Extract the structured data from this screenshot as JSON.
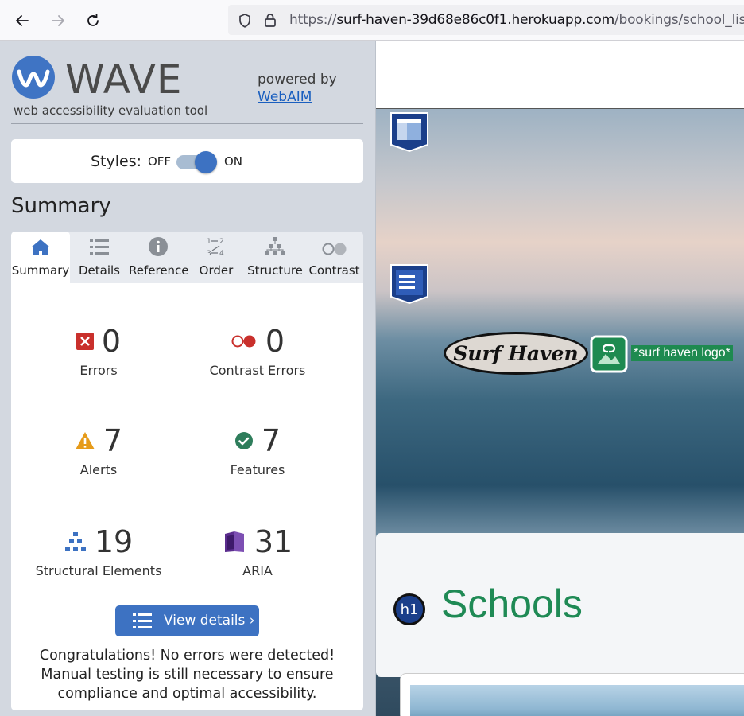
{
  "browser": {
    "url_prefix": "https://",
    "url_host": "surf-haven-39d68e86c0f1.herokuapp.com",
    "url_path": "/bookings/school_list/"
  },
  "wave": {
    "logo_text": "WAVE",
    "subtitle": "web accessibility evaluation tool",
    "powered_by": "powered by",
    "webaim_link": "WebAIM",
    "styles_label": "Styles:",
    "styles_off": "OFF",
    "styles_on": "ON",
    "styles_state": "on",
    "summary_heading": "Summary",
    "tabs": [
      {
        "label": "Summary",
        "icon": "home-icon",
        "active": true
      },
      {
        "label": "Details",
        "icon": "list-icon"
      },
      {
        "label": "Reference",
        "icon": "info-icon"
      },
      {
        "label": "Order",
        "icon": "order-icon"
      },
      {
        "label": "Structure",
        "icon": "structure-icon"
      },
      {
        "label": "Contrast",
        "icon": "contrast-icon"
      }
    ],
    "stats": {
      "errors": {
        "value": "0",
        "label": "Errors"
      },
      "contrast": {
        "value": "0",
        "label": "Contrast Errors"
      },
      "alerts": {
        "value": "7",
        "label": "Alerts"
      },
      "features": {
        "value": "7",
        "label": "Features"
      },
      "structural": {
        "value": "19",
        "label": "Structural Elements"
      },
      "aria": {
        "value": "31",
        "label": "ARIA"
      }
    },
    "view_details": "View details ›",
    "congrats": "Congratulations! No errors were detected! Manual testing is still necessary to ensure compliance and optimal accessibility."
  },
  "site": {
    "logo_text": "Surf Haven",
    "alt_tag": "*surf haven logo*",
    "h1_badge": "h1",
    "page_title": "Schools"
  },
  "colors": {
    "wave_blue": "#3d72c2",
    "error_red": "#c9302c",
    "alert_orange": "#e69b1a",
    "feature_green": "#2e7d5b",
    "aria_purple": "#5b2d8e",
    "schools_green": "#1f8a55"
  }
}
